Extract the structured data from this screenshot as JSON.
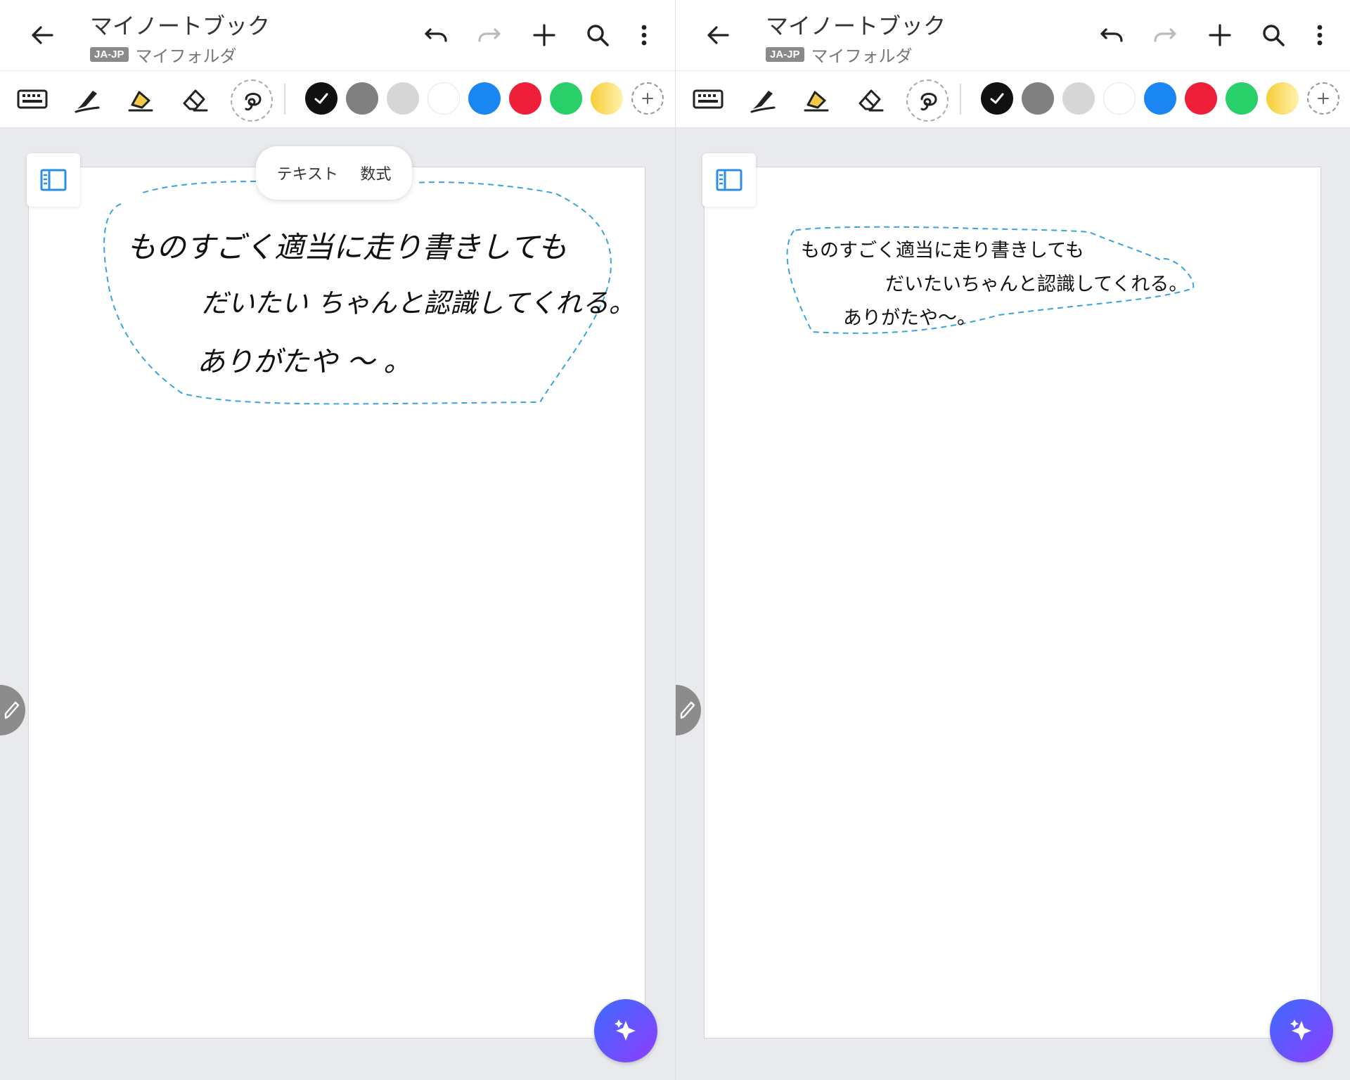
{
  "header": {
    "title": "マイノートブック",
    "lang_badge": "JA-JP",
    "folder": "マイフォルダ"
  },
  "toolbar": {
    "tools": [
      "keyboard-icon",
      "pen-icon",
      "highlighter-icon",
      "eraser-icon",
      "lasso-icon"
    ],
    "colors": [
      "#111111",
      "#808080",
      "#d6d6d6",
      "#ffffff",
      "#1a86f2",
      "#ef1f3a",
      "#29cf69",
      "#f7d548"
    ],
    "selected_color": "#111111"
  },
  "left_panel": {
    "convert_menu": [
      "テキスト",
      "数式"
    ],
    "handwriting": [
      "ものすごく適当に走り書きしても",
      "だいたい ちゃんと認識してくれる。",
      "ありがたや 〜 。"
    ]
  },
  "right_panel": {
    "typed_text": [
      "ものすごく適当に走り書きしても",
      "だいたいちゃんと認識してくれる。",
      "ありがたや〜。"
    ]
  }
}
